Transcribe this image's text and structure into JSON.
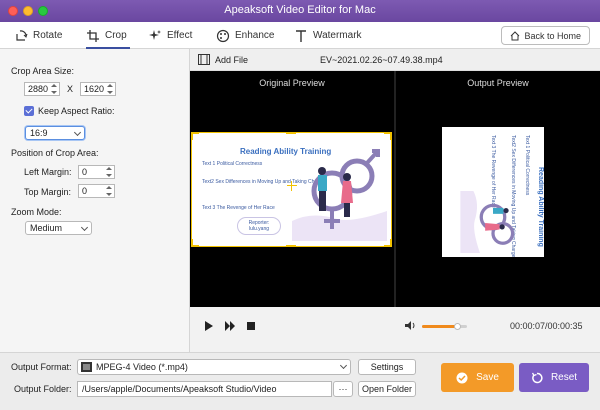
{
  "window": {
    "title": "Apeaksoft Video Editor for Mac"
  },
  "toolbar": {
    "tabs": [
      {
        "label": "Rotate",
        "icon": "rotate-icon"
      },
      {
        "label": "Crop",
        "icon": "crop-icon"
      },
      {
        "label": "Effect",
        "icon": "sparkle-icon"
      },
      {
        "label": "Enhance",
        "icon": "palette-icon"
      },
      {
        "label": "Watermark",
        "icon": "text-t-icon"
      }
    ],
    "active_tab": "Crop",
    "back_label": "Back to Home"
  },
  "crop": {
    "area_size_label": "Crop Area Size:",
    "width": "2880",
    "x_sep": "X",
    "height": "1620",
    "keep_aspect_label": "Keep Aspect Ratio:",
    "keep_aspect_checked": true,
    "aspect_value": "16:9",
    "position_label": "Position of Crop Area:",
    "left_margin_label": "Left Margin:",
    "left_margin": "0",
    "top_margin_label": "Top Margin:",
    "top_margin": "0",
    "zoom_label": "Zoom Mode:",
    "zoom_value": "Medium"
  },
  "preview": {
    "add_file_label": "Add File",
    "file_name": "EV~2021.02.26~07.49.38.mp4",
    "original_label": "Original Preview",
    "output_label": "Output Preview",
    "slide": {
      "title": "Reading Ability Training",
      "item1": "Text 1  Political Correctness",
      "item2": "Text2  Sex Differences in Moving Up and Taking Charge",
      "item3": "Text 3  The Revenge of Her Race",
      "reporter_label": "Reporter:",
      "reporter_name": "lulu.yang"
    }
  },
  "playback": {
    "progress_fraction": 0.36,
    "volume_fraction": 0.78,
    "time": "00:00:07/00:00:35"
  },
  "output": {
    "format_label": "Output Format:",
    "format_value": "MPEG-4 Video (*.mp4)",
    "settings_label": "Settings",
    "folder_label": "Output Folder:",
    "folder_value": "/Users/apple/Documents/Apeaksoft Studio/Video",
    "more_label": "···",
    "open_folder_label": "Open Folder",
    "save_label": "Save",
    "reset_label": "Reset"
  },
  "colors": {
    "titlebar": "#6a47a0",
    "accent_orange": "#f39a28",
    "accent_purple": "#7a5cc4",
    "progress": "#f08a1c",
    "crop_frame": "#f2c200"
  }
}
